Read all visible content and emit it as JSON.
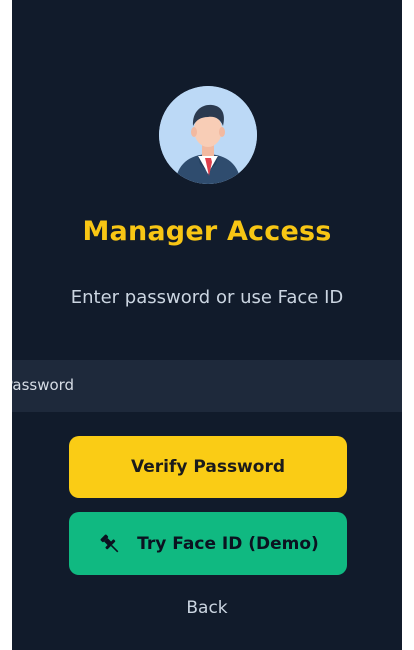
{
  "app": {
    "title": "Manager Access",
    "subtitle": "Enter password or use Face ID",
    "avatar": {
      "icon": "manager-avatar-icon",
      "background": "#bcd9f6"
    }
  },
  "form": {
    "password_placeholder": "Password"
  },
  "actions": {
    "verify_label": "Verify Password",
    "face_id_label": "Try Face ID (Demo)",
    "face_id_icon": "pushpin-icon",
    "back_label": "Back"
  },
  "colors": {
    "background": "#111b2b",
    "accent": "#f8c614",
    "verify_button": "#facc15",
    "face_button": "#10b981",
    "input_bg": "#1e293b"
  }
}
